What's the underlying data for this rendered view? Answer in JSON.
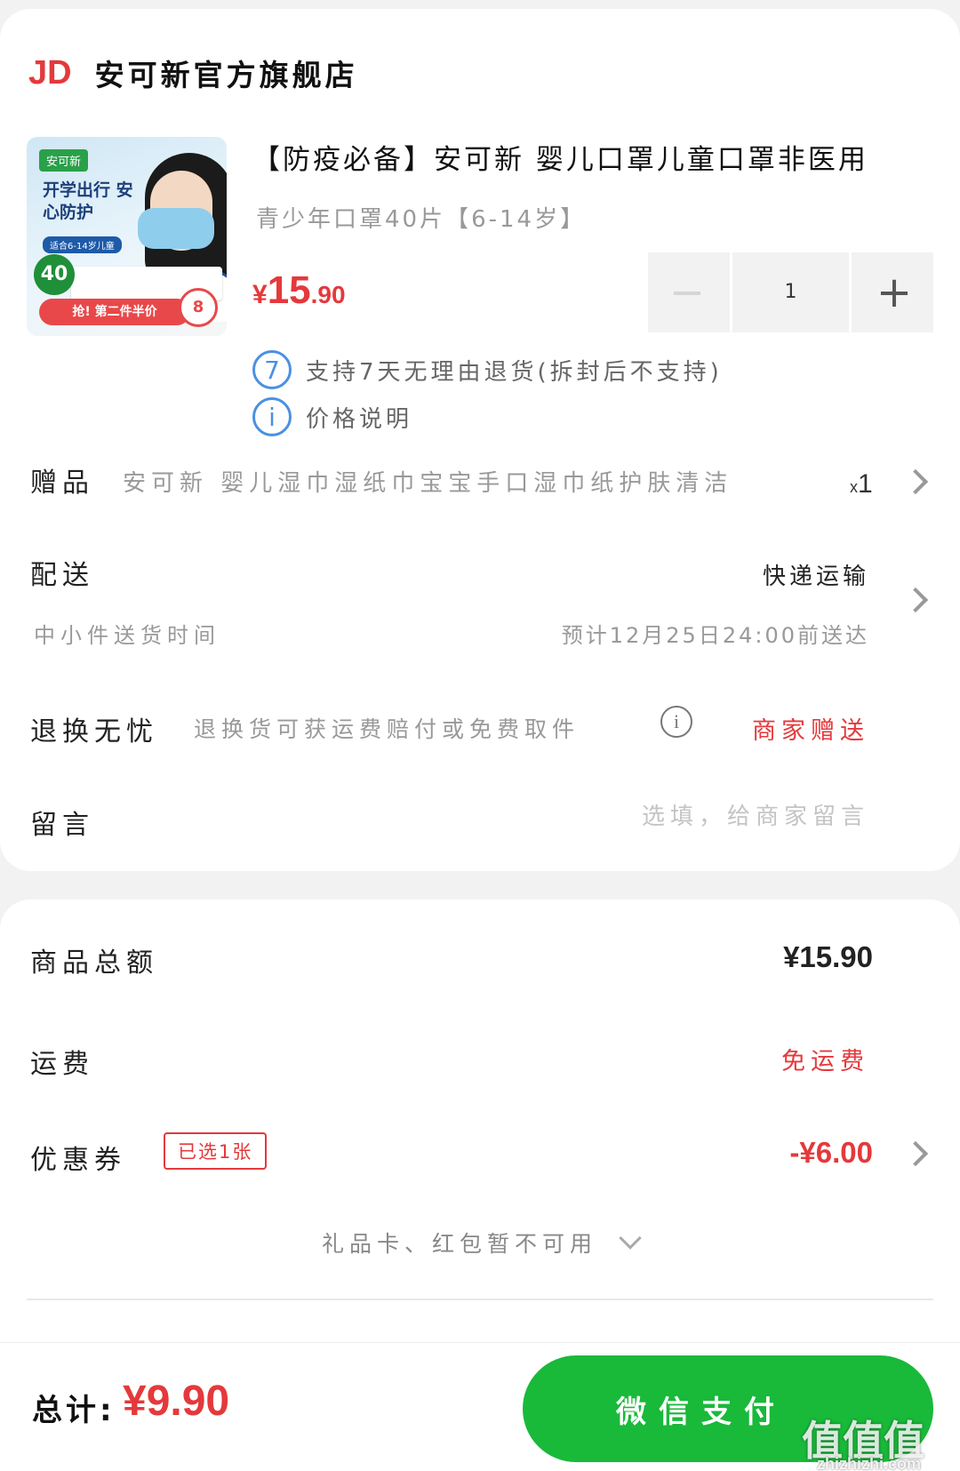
{
  "store": {
    "logo": "JD",
    "name": "安可新官方旗舰店"
  },
  "product": {
    "thumbnail": {
      "badge": "安可新",
      "headline": "开学出行 安心防护",
      "subline": "适合6-14岁儿童",
      "count": "40",
      "ribbon": "抢! 第二件半价",
      "circle": "8"
    },
    "title": "【防疫必备】安可新 婴儿口罩儿童口罩非医用",
    "subtitle": "青少年口罩40片【6-14岁】",
    "price": {
      "symbol": "¥",
      "integer": "15",
      "decimal": ".90"
    },
    "quantity": "1",
    "minus": "−",
    "plus": "+",
    "guarantees": [
      {
        "icon": "7",
        "text": "支持7天无理由退货(拆封后不支持)"
      },
      {
        "icon": "i",
        "text": "价格说明"
      }
    ]
  },
  "gift": {
    "label": "赠品",
    "text": "安可新 婴儿湿巾湿纸巾宝宝手口湿巾纸护肤清洁",
    "qty_prefix": "x",
    "qty": "1"
  },
  "delivery": {
    "label": "配送",
    "method": "快递运输",
    "sub": "中小件送货时间",
    "eta": "预计12月25日24:00前送达"
  },
  "returns": {
    "label": "退换无忧",
    "desc": "退换货可获运费赔付或免费取件",
    "tag": "商家赠送"
  },
  "message": {
    "label": "留言",
    "placeholder": "选填，给商家留言"
  },
  "summary": {
    "goods_label": "商品总额",
    "goods_value": "¥15.90",
    "shipping_label": "运费",
    "shipping_value": "免运费",
    "coupon_label": "优惠券",
    "coupon_tag": "已选1张",
    "coupon_value": "-¥6.00",
    "giftcard_note": "礼品卡、红包暂不可用"
  },
  "footer": {
    "total_label": "总计:",
    "total_value": "¥9.90",
    "pay_button": "微信支付",
    "watermark": "值值值",
    "watermark_url": "zhizhizhi.com"
  },
  "colors": {
    "accent_red": "#e4393c",
    "pay_green": "#19b93a",
    "info_blue": "#4a90e2"
  }
}
